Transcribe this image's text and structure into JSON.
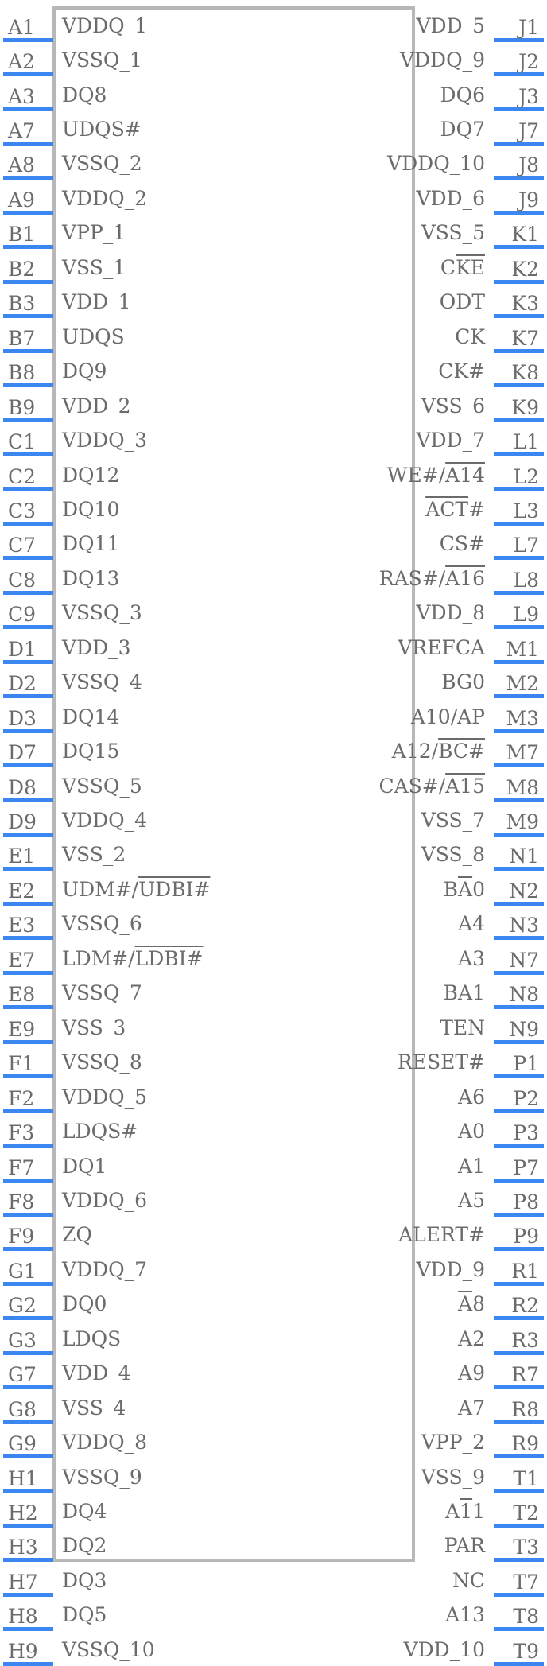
{
  "symbol": {
    "type": "schematic-symbol",
    "description": "DDR4 SDRAM component pin symbol",
    "body_color": "#b8b8b8",
    "pin_line_color": "#3b86f0",
    "text_color": "#6b6b6b",
    "pin_count": 90
  },
  "left_pins": [
    {
      "designator": "A1",
      "name": "VDDQ_1"
    },
    {
      "designator": "A2",
      "name": "VSSQ_1"
    },
    {
      "designator": "A3",
      "name": "DQ8"
    },
    {
      "designator": "A7",
      "name": "UDQS#"
    },
    {
      "designator": "A8",
      "name": "VSSQ_2"
    },
    {
      "designator": "A9",
      "name": "VDDQ_2"
    },
    {
      "designator": "B1",
      "name": "VPP_1"
    },
    {
      "designator": "B2",
      "name": "VSS_1"
    },
    {
      "designator": "B3",
      "name": "VDD_1"
    },
    {
      "designator": "B7",
      "name": "UDQS"
    },
    {
      "designator": "B8",
      "name": "DQ9"
    },
    {
      "designator": "B9",
      "name": "VDD_2"
    },
    {
      "designator": "C1",
      "name": "VDDQ_3"
    },
    {
      "designator": "C2",
      "name": "DQ12"
    },
    {
      "designator": "C3",
      "name": "DQ10"
    },
    {
      "designator": "C7",
      "name": "DQ11"
    },
    {
      "designator": "C8",
      "name": "DQ13"
    },
    {
      "designator": "C9",
      "name": "VSSQ_3"
    },
    {
      "designator": "D1",
      "name": "VDD_3"
    },
    {
      "designator": "D2",
      "name": "VSSQ_4"
    },
    {
      "designator": "D3",
      "name": "DQ14"
    },
    {
      "designator": "D7",
      "name": "DQ15"
    },
    {
      "designator": "D8",
      "name": "VSSQ_5"
    },
    {
      "designator": "D9",
      "name": "VDDQ_4"
    },
    {
      "designator": "E1",
      "name": "VSS_2"
    },
    {
      "designator": "E2",
      "name": "UDM#/_UDBI#"
    },
    {
      "designator": "E3",
      "name": "VSSQ_6"
    },
    {
      "designator": "E7",
      "name": "LDM#/_LDBI#"
    },
    {
      "designator": "E8",
      "name": "VSSQ_7"
    },
    {
      "designator": "E9",
      "name": "VSS_3"
    },
    {
      "designator": "F1",
      "name": "VSSQ_8"
    },
    {
      "designator": "F2",
      "name": "VDDQ_5"
    },
    {
      "designator": "F3",
      "name": "LDQS#"
    },
    {
      "designator": "F7",
      "name": "DQ1"
    },
    {
      "designator": "F8",
      "name": "VDDQ_6"
    },
    {
      "designator": "F9",
      "name": "ZQ"
    },
    {
      "designator": "G1",
      "name": "VDDQ_7"
    },
    {
      "designator": "G2",
      "name": "DQ0"
    },
    {
      "designator": "G3",
      "name": "LDQS"
    },
    {
      "designator": "G7",
      "name": "VDD_4"
    },
    {
      "designator": "G8",
      "name": "VSS_4"
    },
    {
      "designator": "G9",
      "name": "VDDQ_8"
    },
    {
      "designator": "H1",
      "name": "VSSQ_9"
    },
    {
      "designator": "H2",
      "name": "DQ4"
    },
    {
      "designator": "H3",
      "name": "DQ2"
    },
    {
      "designator": "H7",
      "name": "DQ3"
    },
    {
      "designator": "H8",
      "name": "DQ5"
    },
    {
      "designator": "H9",
      "name": "VSSQ_10"
    }
  ],
  "right_pins": [
    {
      "designator": "J1",
      "name": "VDD_5"
    },
    {
      "designator": "J2",
      "name": "VDDQ_9"
    },
    {
      "designator": "J3",
      "name": "DQ6"
    },
    {
      "designator": "J7",
      "name": "DQ7"
    },
    {
      "designator": "J8",
      "name": "VDDQ_10"
    },
    {
      "designator": "J9",
      "name": "VDD_6"
    },
    {
      "designator": "K1",
      "name": "VSS_5"
    },
    {
      "designator": "K2",
      "name": "CKE",
      "overline": "KE"
    },
    {
      "designator": "K3",
      "name": "ODT"
    },
    {
      "designator": "K7",
      "name": "CK"
    },
    {
      "designator": "K8",
      "name": "CK#"
    },
    {
      "designator": "K9",
      "name": "VSS_6"
    },
    {
      "designator": "L1",
      "name": "VDD_7"
    },
    {
      "designator": "L2",
      "name": "WE#/_A14"
    },
    {
      "designator": "L3",
      "name": "ACT#",
      "overline": "ACT"
    },
    {
      "designator": "L7",
      "name": "CS#"
    },
    {
      "designator": "L8",
      "name": "RAS#/_A16"
    },
    {
      "designator": "L9",
      "name": "VDD_8"
    },
    {
      "designator": "M1",
      "name": "VREFCA"
    },
    {
      "designator": "M2",
      "name": "BG0"
    },
    {
      "designator": "M3",
      "name": "A10/AP"
    },
    {
      "designator": "M7",
      "name": "A12/_BC#"
    },
    {
      "designator": "M8",
      "name": "CAS#/_A15"
    },
    {
      "designator": "M9",
      "name": "VSS_7"
    },
    {
      "designator": "N1",
      "name": "VSS_8"
    },
    {
      "designator": "N2",
      "name": "BA0",
      "overline": "A"
    },
    {
      "designator": "N3",
      "name": "A4"
    },
    {
      "designator": "N7",
      "name": "A3"
    },
    {
      "designator": "N8",
      "name": "BA1"
    },
    {
      "designator": "N9",
      "name": "TEN"
    },
    {
      "designator": "P1",
      "name": "RESET#"
    },
    {
      "designator": "P2",
      "name": "A6"
    },
    {
      "designator": "P3",
      "name": "A0"
    },
    {
      "designator": "P7",
      "name": "A1"
    },
    {
      "designator": "P8",
      "name": "A5"
    },
    {
      "designator": "P9",
      "name": "ALERT#"
    },
    {
      "designator": "R1",
      "name": "VDD_9"
    },
    {
      "designator": "R2",
      "name": "A8",
      "overline": "A"
    },
    {
      "designator": "R3",
      "name": "A2"
    },
    {
      "designator": "R7",
      "name": "A9"
    },
    {
      "designator": "R8",
      "name": "A7"
    },
    {
      "designator": "R9",
      "name": "VPP_2"
    },
    {
      "designator": "T1",
      "name": "VSS_9"
    },
    {
      "designator": "T2",
      "name": "A11",
      "overline": "1"
    },
    {
      "designator": "T3",
      "name": "PAR"
    },
    {
      "designator": "T7",
      "name": "NC"
    },
    {
      "designator": "T8",
      "name": "A13"
    },
    {
      "designator": "T9",
      "name": "VDD_10"
    }
  ]
}
